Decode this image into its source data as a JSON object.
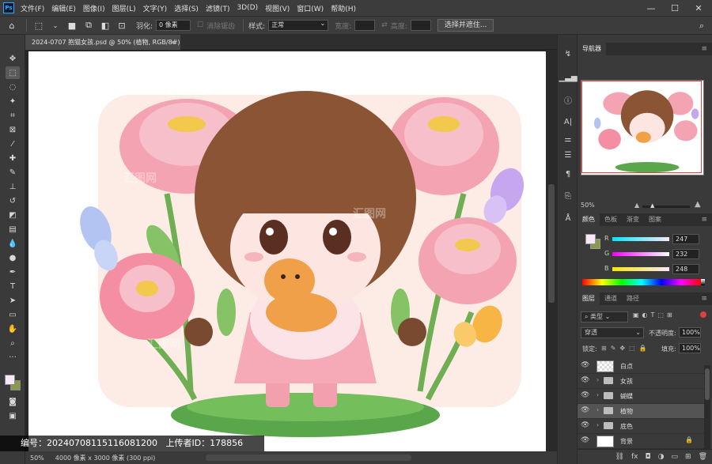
{
  "app": {
    "logo": "Ps"
  },
  "menu": [
    "文件(F)",
    "编辑(E)",
    "图像(I)",
    "图层(L)",
    "文字(Y)",
    "选择(S)",
    "滤镜(T)",
    "3D(D)",
    "视图(V)",
    "窗口(W)",
    "帮助(H)"
  ],
  "window_controls": {
    "minimize": "—",
    "maximize": "☐",
    "close": "✕"
  },
  "options": {
    "feather_label": "羽化:",
    "feather_value": "0 像素",
    "antialias_label": "消除锯齿",
    "style_label": "样式:",
    "style_value": "正常",
    "width_label": "宽度:",
    "height_label": "高度:",
    "select_mask_button": "选择并遮住..."
  },
  "document": {
    "tab_title": "2024-0707 抱猫女孩.psd @ 50% (植物, RGB/8#)",
    "close": "×",
    "zoom": "50%",
    "size_info": "4000 像素 x 3000 像素 (300 ppi)"
  },
  "navigator": {
    "tab": "导航器",
    "zoom": "50%"
  },
  "color_panel": {
    "tabs": [
      "颜色",
      "色板",
      "渐变",
      "图案"
    ],
    "channels": [
      {
        "label": "R",
        "value": "247"
      },
      {
        "label": "G",
        "value": "232"
      },
      {
        "label": "B",
        "value": "248"
      }
    ],
    "foreground": "#f7e8f8",
    "background": "#8a9a4c"
  },
  "layers_panel": {
    "tabs": [
      "图层",
      "通道",
      "路径"
    ],
    "filter_label": "类型",
    "blend_mode": "穿透",
    "opacity_label": "不透明度:",
    "opacity_value": "100%",
    "lock_label": "锁定:",
    "fill_label": "填充:",
    "fill_value": "100%",
    "layers": [
      {
        "name": "白点",
        "type": "pixel",
        "selected": false
      },
      {
        "name": "女孩",
        "type": "group",
        "selected": false
      },
      {
        "name": "蝴蝶",
        "type": "group",
        "selected": false
      },
      {
        "name": "植物",
        "type": "group",
        "selected": true
      },
      {
        "name": "底色",
        "type": "group",
        "selected": false
      },
      {
        "name": "背景",
        "type": "background",
        "selected": false
      }
    ]
  },
  "watermark": {
    "text": "编号：20240708115116081200   上传者ID：178856",
    "overlay_text": "汇图网"
  }
}
